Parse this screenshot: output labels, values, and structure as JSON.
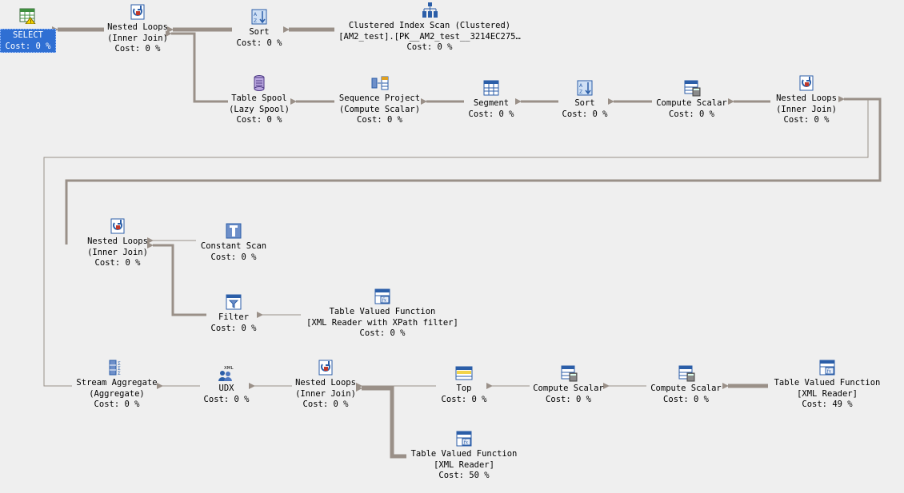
{
  "operators": {
    "select": {
      "label": "SELECT",
      "cost": "Cost: 0 %"
    },
    "nl1": {
      "l1": "Nested Loops",
      "l2": "(Inner Join)",
      "cost": "Cost: 0 %"
    },
    "sort1": {
      "l1": "Sort",
      "cost": "Cost: 0 %"
    },
    "cis": {
      "l1": "Clustered Index Scan (Clustered)",
      "l2": "[AM2_test].[PK__AM2_test__3214EC275…",
      "cost": "Cost: 0 %"
    },
    "spool": {
      "l1": "Table Spool",
      "l2": "(Lazy Spool)",
      "cost": "Cost: 0 %"
    },
    "seqproj": {
      "l1": "Sequence Project",
      "l2": "(Compute Scalar)",
      "cost": "Cost: 0 %"
    },
    "segment": {
      "l1": "Segment",
      "cost": "Cost: 0 %"
    },
    "sort2": {
      "l1": "Sort",
      "cost": "Cost: 0 %"
    },
    "cs1": {
      "l1": "Compute Scalar",
      "cost": "Cost: 0 %"
    },
    "nl2": {
      "l1": "Nested Loops",
      "l2": "(Inner Join)",
      "cost": "Cost: 0 %"
    },
    "nl3": {
      "l1": "Nested Loops",
      "l2": "(Inner Join)",
      "cost": "Cost: 0 %"
    },
    "constscan": {
      "l1": "Constant Scan",
      "cost": "Cost: 0 %"
    },
    "filter": {
      "l1": "Filter",
      "cost": "Cost: 0 %"
    },
    "tvf1": {
      "l1": "Table Valued Function",
      "l2": "[XML Reader with XPath filter]",
      "cost": "Cost: 0 %"
    },
    "streamagg": {
      "l1": "Stream Aggregate",
      "l2": "(Aggregate)",
      "cost": "Cost: 0 %"
    },
    "udx": {
      "l1": "UDX",
      "cost": "Cost: 0 %",
      "icon_text": "XML"
    },
    "nl4": {
      "l1": "Nested Loops",
      "l2": "(Inner Join)",
      "cost": "Cost: 0 %"
    },
    "top": {
      "l1": "Top",
      "cost": "Cost: 0 %"
    },
    "cs2": {
      "l1": "Compute Scalar",
      "cost": "Cost: 0 %"
    },
    "cs3": {
      "l1": "Compute Scalar",
      "cost": "Cost: 0 %"
    },
    "tvf2": {
      "l1": "Table Valued Function",
      "l2": "[XML Reader]",
      "cost": "Cost: 49 %"
    },
    "tvf3": {
      "l1": "Table Valued Function",
      "l2": "[XML Reader]",
      "cost": "Cost: 50 %"
    }
  },
  "colors": {
    "background": "#efefef",
    "arrow": "#9a9088",
    "selected": "#2f6fd3"
  }
}
